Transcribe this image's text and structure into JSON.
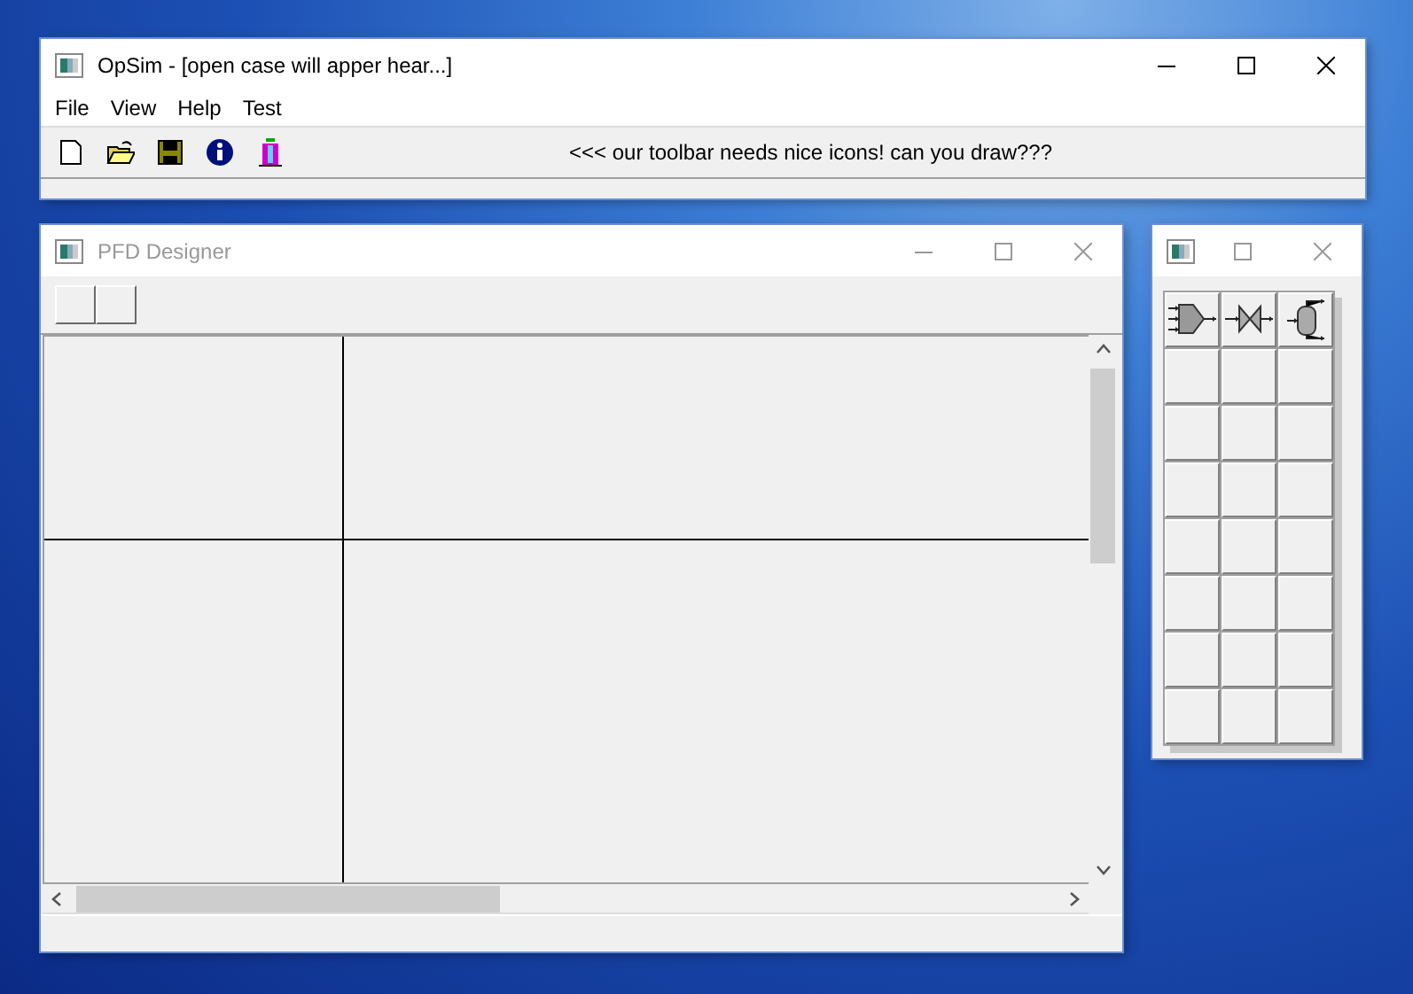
{
  "main_window": {
    "title": "OpSim - [open case will apper hear...]",
    "active": true,
    "menu": [
      "File",
      "View",
      "Help",
      "Test"
    ],
    "toolbar": [
      {
        "kind": "new"
      },
      {
        "kind": "open"
      },
      {
        "kind": "save"
      },
      {
        "kind": "info"
      },
      {
        "kind": "column"
      }
    ],
    "toolbar_message": "<<< our toolbar needs nice icons! can you draw???"
  },
  "pfd_window": {
    "title": "PFD Designer",
    "active": false
  },
  "palette_window": {
    "items": [
      {
        "kind": "mixer"
      },
      {
        "kind": "valve"
      },
      {
        "kind": "vessel"
      }
    ]
  }
}
